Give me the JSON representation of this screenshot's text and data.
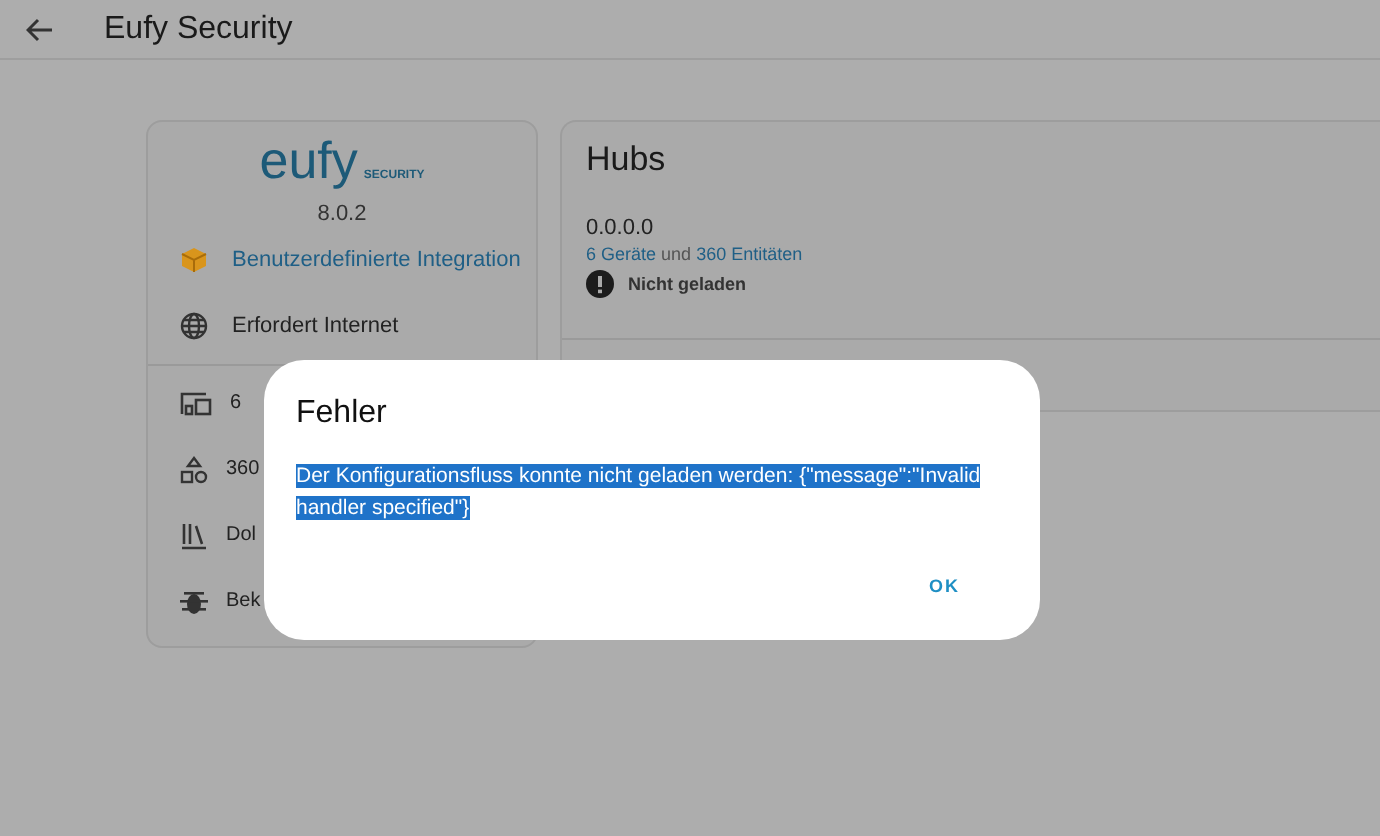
{
  "header": {
    "title": "Eufy Security"
  },
  "integration": {
    "logo_word": "eufy",
    "logo_sub": "SECURITY",
    "version": "8.0.2",
    "items": [
      {
        "kind": "custom",
        "label": "Benutzerdefinierte Integration"
      },
      {
        "kind": "internet",
        "label": "Erfordert Internet"
      }
    ],
    "links": [
      {
        "kind": "devices",
        "label": "6"
      },
      {
        "kind": "entities",
        "label": "360"
      },
      {
        "kind": "docs",
        "label": "Dol"
      },
      {
        "kind": "issues",
        "label": "Bek"
      }
    ]
  },
  "hubs": {
    "title": "Hubs",
    "entry": {
      "name": "0.0.0.0",
      "devices_link": "6 Geräte",
      "joiner": "und",
      "entities_link": "360 Entitäten",
      "status": "Nicht geladen"
    }
  },
  "dialog": {
    "title": "Fehler",
    "message": "Der Konfigurationsfluss konnte nicht geladen werden: {\"message\":\"Invalid handler specified\"}",
    "message_selected": true,
    "buttons": [
      "OK"
    ]
  }
}
